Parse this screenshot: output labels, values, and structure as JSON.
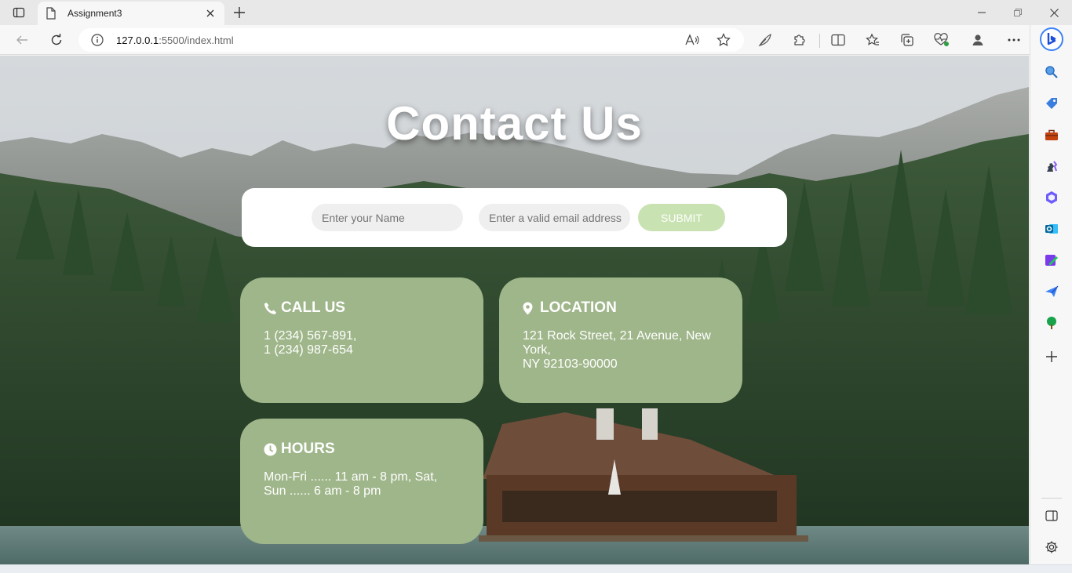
{
  "browser": {
    "tab_title": "Assignment3",
    "url_host": "127.0.0.1",
    "url_rest": ":5500/index.html"
  },
  "page": {
    "heading": "Contact Us",
    "form": {
      "name_placeholder": "Enter your Name",
      "email_placeholder": "Enter a valid email address",
      "submit_label": "SUBMIT"
    },
    "cards": {
      "call": {
        "title": "CALL US",
        "lines": [
          "1 (234) 567-891,",
          "1 (234) 987-654"
        ]
      },
      "location": {
        "title": "LOCATION",
        "lines": [
          "121 Rock Street, 21 Avenue, New",
          "York,",
          "NY 92103-90000"
        ]
      },
      "hours": {
        "title": "HOURS",
        "lines": [
          "Mon-Fri ...... 11 am - 8 pm, Sat,",
          "Sun ...... 6 am - 8 pm"
        ]
      }
    }
  },
  "colors": {
    "card_green": "#9fb68a",
    "submit_green": "#c8e2b1",
    "form_bg": "#ffffff",
    "input_bg": "#efefef"
  },
  "icons": [
    "tab-actions-icon",
    "page-icon",
    "close-tab-icon",
    "new-tab-icon",
    "minimize-icon",
    "restore-icon",
    "close-window-icon",
    "back-icon",
    "refresh-icon",
    "info-icon",
    "read-aloud-icon",
    "favorite-star-icon",
    "feather-icon",
    "extensions-icon",
    "split-screen-icon",
    "favorites-icon",
    "collections-icon",
    "heart-pulse-icon",
    "profile-icon",
    "more-icon",
    "bing-icon",
    "search-icon",
    "tag-icon",
    "toolbox-icon",
    "chess-icon",
    "office-icon",
    "outlook-icon",
    "designer-icon",
    "send-icon",
    "tree-icon",
    "add-icon",
    "sidebar-toggle-icon",
    "settings-icon",
    "phone-icon",
    "map-pin-icon",
    "clock-icon"
  ]
}
